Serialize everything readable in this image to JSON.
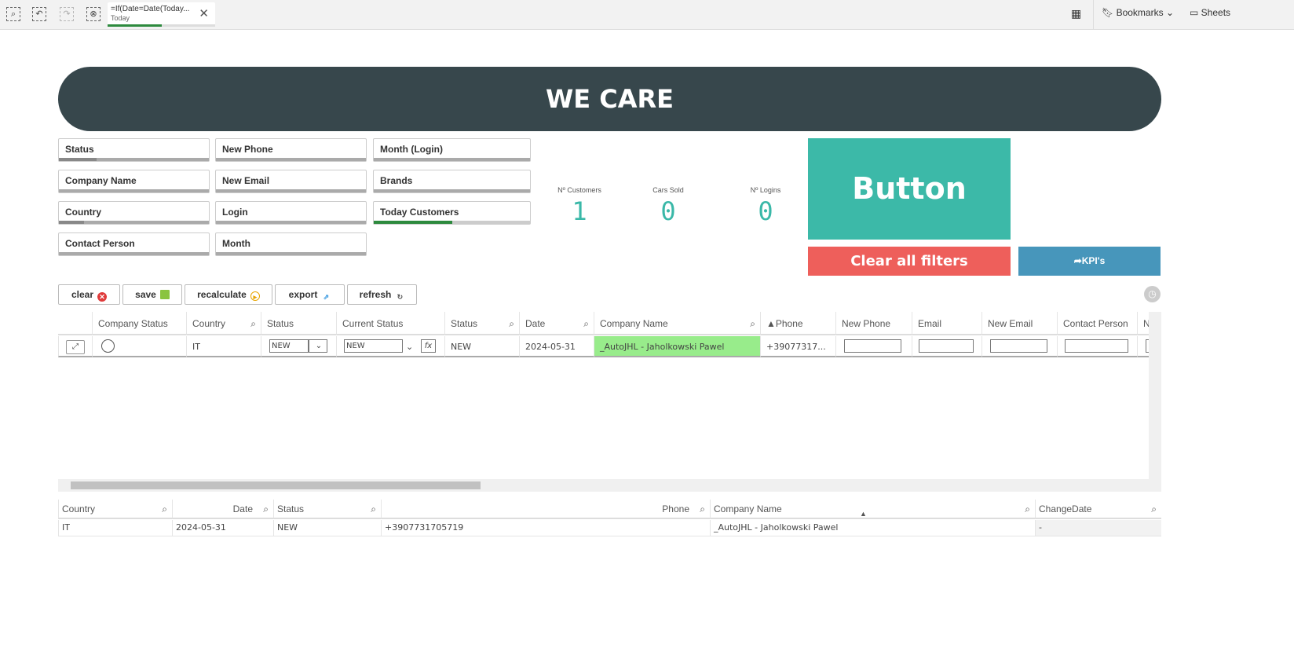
{
  "toolbar": {
    "icons": [
      "smart-search-icon",
      "step-back-icon",
      "step-forward-icon",
      "clear-selections-icon"
    ],
    "selection": {
      "title": "=If(Date=Date(Today...",
      "value": "Today",
      "progress": 0.5
    },
    "bookmarks": "Bookmarks",
    "sheets": "Sheets"
  },
  "banner": "WE CARE",
  "filters": [
    "Status",
    "New Phone",
    "Month (Login)",
    "Company Name",
    "New Email",
    "Brands",
    "Country",
    "Login",
    "Today Customers",
    "Contact Person",
    "Month"
  ],
  "kpis": [
    {
      "label": "Nº Customers",
      "value": "1"
    },
    {
      "label": "Cars Sold",
      "value": "0"
    },
    {
      "label": "Nº Logins",
      "value": "0"
    }
  ],
  "big_button": "Button",
  "clear_filters": "Clear all filters",
  "kpi_link": "➦KPI's",
  "actions": [
    "clear",
    "save",
    "recalculate",
    "export",
    "refresh"
  ],
  "table1": {
    "headers": [
      "Company Status",
      "Country",
      "Status",
      "Current Status",
      "Status",
      "Date",
      "Company Name",
      "▲Phone",
      "New Phone",
      "Email",
      "New Email",
      "Contact Person",
      "N"
    ],
    "row": {
      "country": "IT",
      "status_sel": "NEW",
      "current_status": "NEW",
      "status": "NEW",
      "date": "2024-05-31",
      "company": "_AutoJHL - Jaholkowski Pawel",
      "phone": "+39077317..."
    }
  },
  "table2": {
    "headers": [
      "Country",
      "Date",
      "Status",
      "Phone",
      "Company Name",
      "ChangeDate"
    ],
    "row": [
      "IT",
      "2024-05-31",
      "NEW",
      "+3907731705719",
      "_AutoJHL - Jaholkowski Pawel",
      "-"
    ]
  },
  "colors": {
    "banner": "#37474c",
    "teal": "#3cb9a8",
    "red": "#ee5f5b",
    "blue": "#4796bb",
    "highlight": "#98ec8b"
  }
}
